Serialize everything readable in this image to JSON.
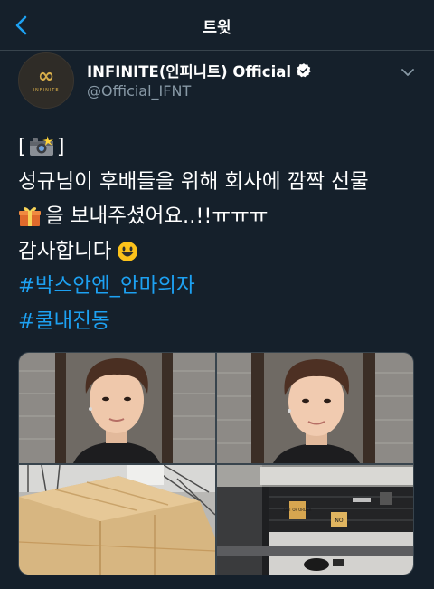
{
  "header": {
    "title": "트윗"
  },
  "colors": {
    "accent": "#1da1f2",
    "background": "#15202b",
    "muted": "#8899a6",
    "border": "#38444d"
  },
  "tweet": {
    "display_name": "INFINITE(인피니트) Official",
    "handle": "@Official_IFNT",
    "avatar_mark": "∞",
    "avatar_word": "INFINITE",
    "lines": {
      "l1_bracket_open": "[",
      "l1_bracket_close": "]",
      "l2": "성규님이 후배들을 위해 회사에 깜짝 선물",
      "l3": "을 보내주셨어요..!!ㅠㅠㅠ",
      "l4": "감사합니다"
    },
    "hashtags": [
      "#박스안엔_안마의자",
      "#쿨내진동"
    ],
    "photos": {
      "sign1": "OUT OF ORDER",
      "sign2": "NO"
    }
  },
  "icons": [
    "back-arrow-icon",
    "verified-badge-icon",
    "chevron-down-icon",
    "camera-flash-emoji",
    "gift-emoji",
    "smiley-emoji"
  ]
}
